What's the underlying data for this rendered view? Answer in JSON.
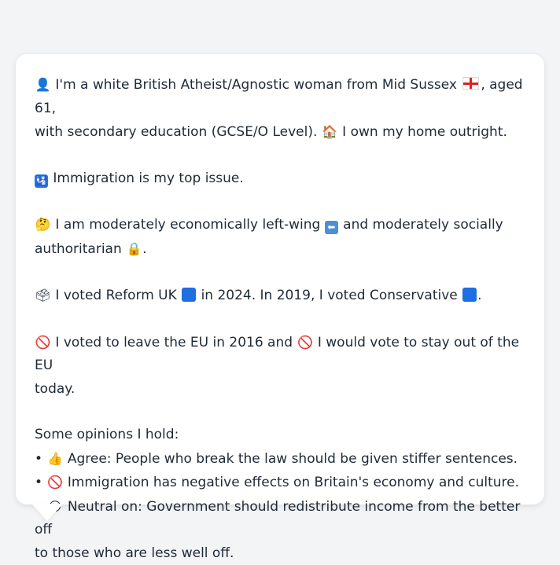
{
  "profile": {
    "intro_a": "I'm a white British Atheist/Agnostic woman from Mid Sussex",
    "intro_b": ", aged 61,",
    "intro_c": "with secondary education (GCSE/O Level).",
    "intro_d": "I own my home outright.",
    "top_issue": "Immigration is my top issue.",
    "econ_a": "I am moderately economically left-wing",
    "econ_b": "and moderately socially",
    "econ_c": "authoritarian",
    "econ_d": ".",
    "vote_a": "I voted Reform UK",
    "vote_b": "in 2024. In 2019, I voted Conservative",
    "vote_c": ".",
    "eu_a": "I voted to leave the EU in 2016 and",
    "eu_b": "I would vote to stay out of the EU",
    "eu_c": "today.",
    "opinions_header": "Some opinions I hold:",
    "opinion_1": "Agree: People who break the law should be given stiffer sentences.",
    "opinion_2": "Immigration has negative effects on Britain's economy and culture.",
    "opinion_3a": "Neutral on: Government should redistribute income from the better off",
    "opinion_3b": "to those who are less well off.",
    "bullet": "•"
  },
  "icons": {
    "person": "bust-in-silhouette-icon",
    "flag": "england-flag-icon",
    "house": "house-icon",
    "issue": "passport-control-icon",
    "thinking": "thinking-face-icon",
    "left_arrow": "left-arrow-icon",
    "lock": "locked-icon",
    "ballot": "ballot-box-icon",
    "reform_square": "blue-square-icon",
    "conservative_square": "blue-square-icon",
    "prohibited": "prohibited-icon",
    "thumbs_up": "thumbs-up-icon",
    "neutral": "neutral-face-icon"
  },
  "colors": {
    "reform": "#1e6fe0",
    "conservative": "#1e6fe0",
    "bubble_bg": "#ffffff",
    "page_bg": "#f3f4f6",
    "text": "#1f2a37"
  }
}
